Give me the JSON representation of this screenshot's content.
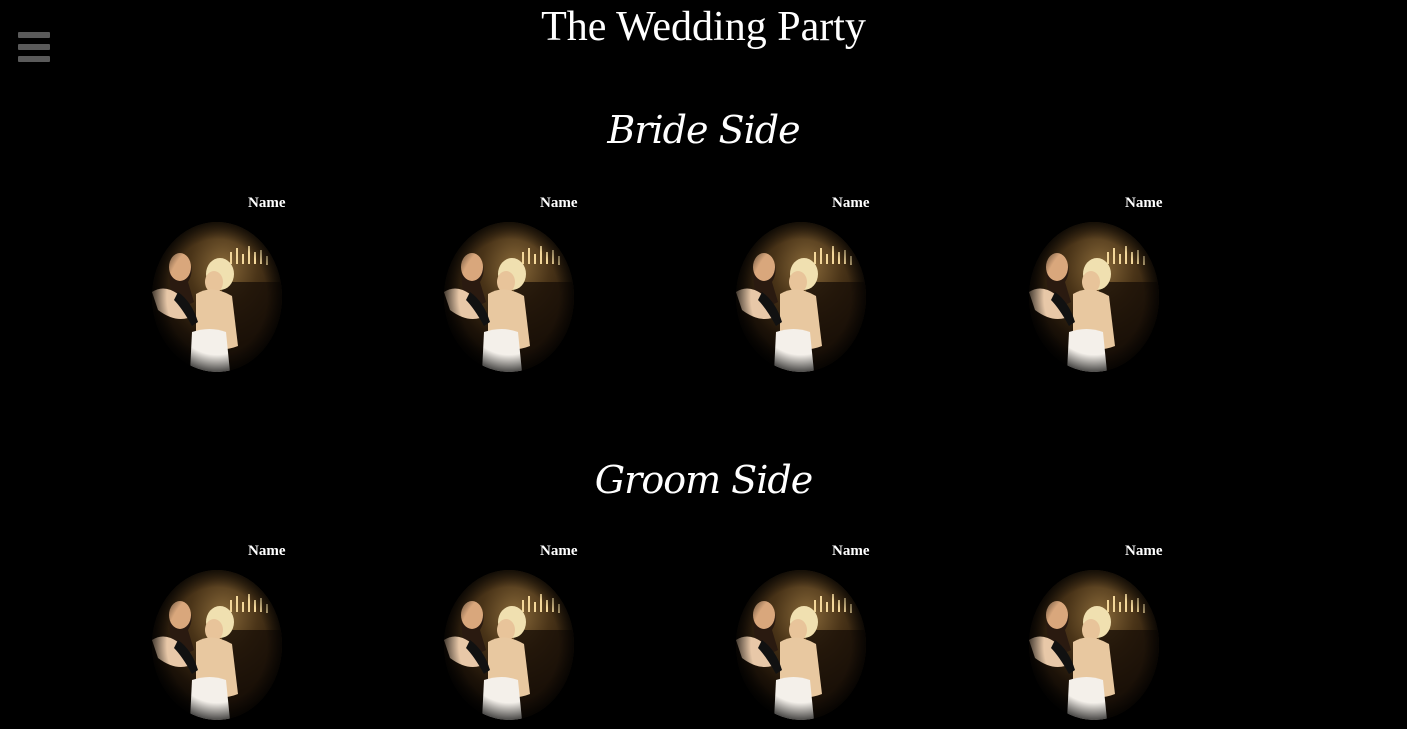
{
  "page": {
    "title": "The Wedding Party",
    "menu_icon": "hamburger-menu-icon"
  },
  "sections": {
    "bride": {
      "title": "Bride Side",
      "members": [
        {
          "name": "Name"
        },
        {
          "name": "Name"
        },
        {
          "name": "Name"
        },
        {
          "name": "Name"
        }
      ]
    },
    "groom": {
      "title": "Groom Side",
      "members": [
        {
          "name": "Name"
        },
        {
          "name": "Name"
        },
        {
          "name": "Name"
        },
        {
          "name": "Name"
        }
      ]
    }
  },
  "colors": {
    "background": "#000000",
    "text": "#ffffff",
    "menu_icon": "#5a5a5a"
  }
}
